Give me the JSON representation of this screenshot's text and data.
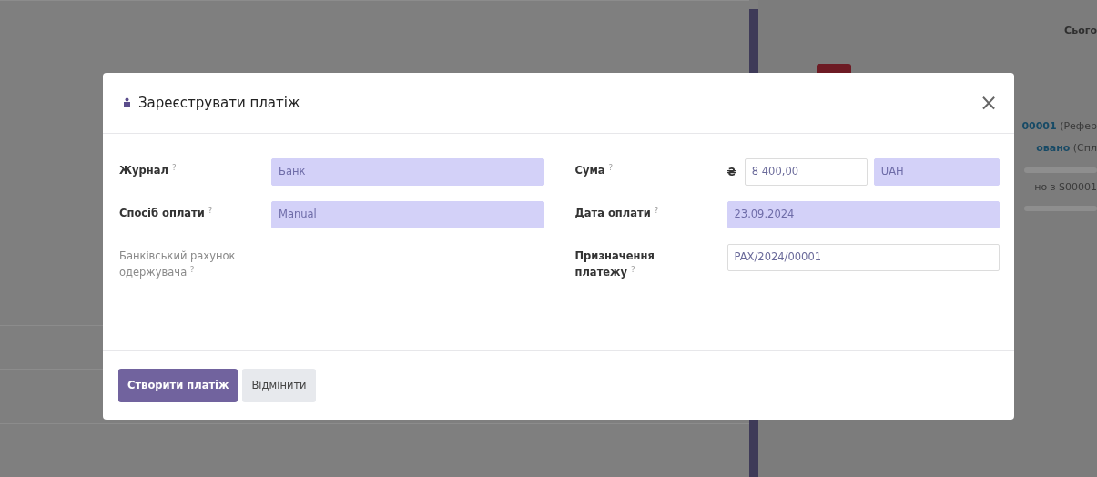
{
  "background": {
    "side_heading": "Сього",
    "log": [
      {
        "link": "00001",
        "note": "(Рефер"
      },
      {
        "link": "овано",
        "note": "(Спл"
      },
      {
        "note": "но з S00001"
      }
    ]
  },
  "modal": {
    "title": "Зареєструвати платіж",
    "close": "×",
    "left_fields": [
      {
        "label": "Журнал",
        "help": "?",
        "muted": false,
        "kind": "select",
        "value": "Банк"
      },
      {
        "label": "Спосіб оплати",
        "help": "?",
        "muted": false,
        "kind": "select",
        "value": "Manual"
      },
      {
        "label": "Банківський рахунок одержувача",
        "help": "?",
        "muted": true,
        "kind": "none"
      }
    ],
    "right_fields": [
      {
        "label": "Сума",
        "help": "?",
        "muted": false,
        "kind": "amount",
        "symbol": "₴",
        "value": "8 400,00",
        "currency": "UAH"
      },
      {
        "label": "Дата оплати",
        "help": "?",
        "muted": false,
        "kind": "select",
        "value": "23.09.2024"
      },
      {
        "label": "Призначення платежу",
        "help": "?",
        "muted": false,
        "kind": "text",
        "value": "PAX/2024/00001"
      }
    ],
    "buttons": [
      {
        "label": "Створити платіж",
        "kind": "primary"
      },
      {
        "label": "Відмінити",
        "kind": "secondary"
      }
    ]
  }
}
